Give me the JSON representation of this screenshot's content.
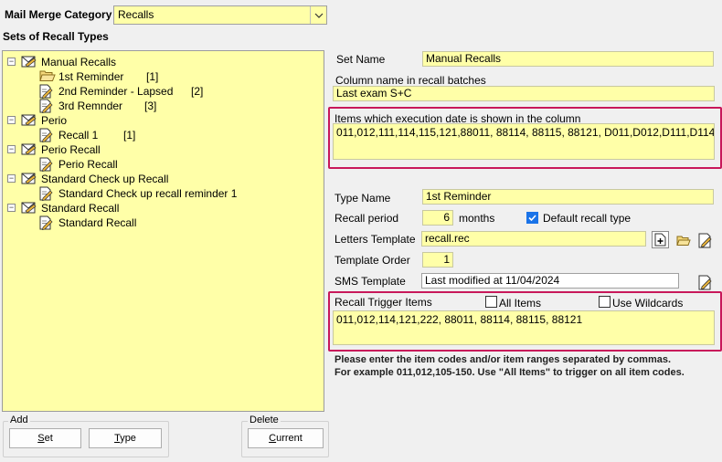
{
  "header": {
    "category_label": "Mail Merge Category",
    "category_value": "Recalls",
    "sets_label": "Sets of Recall Types"
  },
  "tree": [
    {
      "label": "Manual Recalls",
      "type": "set",
      "expanded": true
    },
    {
      "label": "1st Reminder",
      "type": "item",
      "count": "[1]",
      "selected": true
    },
    {
      "label": "2nd Reminder - Lapsed",
      "type": "item",
      "count": "[2]"
    },
    {
      "label": "3rd Remnder",
      "type": "item",
      "count": "[3]"
    },
    {
      "label": "Perio",
      "type": "set",
      "expanded": true
    },
    {
      "label": "Recall 1",
      "type": "item",
      "count": "[1]"
    },
    {
      "label": "Perio Recall",
      "type": "set",
      "expanded": true
    },
    {
      "label": "Perio Recall",
      "type": "item"
    },
    {
      "label": "Standard Check up Recall",
      "type": "set",
      "expanded": true
    },
    {
      "label": "Standard Check up recall reminder 1",
      "type": "item"
    },
    {
      "label": "Standard Recall",
      "type": "set",
      "expanded": true
    },
    {
      "label": "Standard Recall",
      "type": "item"
    }
  ],
  "add_group": {
    "label": "Add",
    "set_button": {
      "accel": "S",
      "rest": "et"
    },
    "type_button": {
      "accel": "T",
      "rest": "ype"
    }
  },
  "delete_group": {
    "label": "Delete",
    "current_button": {
      "accel": "C",
      "rest": "urrent"
    }
  },
  "set": {
    "name_label": "Set Name",
    "name_value": "Manual Recalls",
    "column_label": "Column name in recall batches",
    "column_value": "Last exam S+C",
    "items_label": "Items which execution date is shown in the column",
    "items_value": "011,012,111,114,115,121,88011, 88114, 88115, 88121, D011,D012,D111,D114"
  },
  "type": {
    "name_label": "Type Name",
    "name_value": "1st Reminder",
    "period_label": "Recall period",
    "period_value": "6",
    "period_unit": "months",
    "default_label": "Default recall type",
    "default_checked": true,
    "letters_label": "Letters Template",
    "letters_value": "recall.rec",
    "order_label": "Template Order",
    "order_value": "1",
    "sms_label": "SMS Template",
    "sms_value": "Last modified at 11/04/2024"
  },
  "trigger": {
    "label": "Recall Trigger Items",
    "all_items_label": "All Items",
    "all_items_checked": false,
    "wildcards_label": "Use Wildcards",
    "wildcards_checked": false,
    "value": "011,012,114,121,222, 88011, 88114, 88115, 88121",
    "note_line1": "Please enter the item codes and/or item ranges separated by commas.",
    "note_line2": "For example 011,012,105-150. Use \"All Items\" to trigger on all item codes."
  },
  "colors": {
    "field_yellow": "#ffffa8",
    "highlight_red": "#c8185a",
    "checkbox_blue": "#1a73e8"
  }
}
